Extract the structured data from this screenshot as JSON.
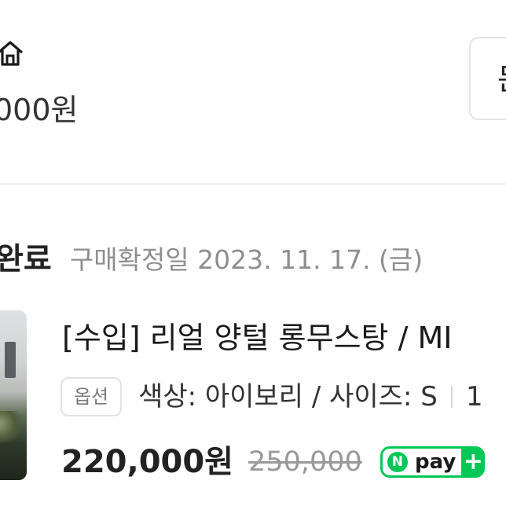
{
  "top": {
    "store_icon": "store-icon",
    "amount_text": "000원",
    "right_button_label": "문"
  },
  "order": {
    "status": "완료",
    "confirm_date": "구매확정일 2023. 11. 17. (금)"
  },
  "product": {
    "title": "[수입] 리얼 양털 롱무스탕 / MI",
    "option_badge": "옵션",
    "option_value": "색상: 아이보리 / 사이즈: S",
    "option_extra": "1",
    "sale_price": "220,000원",
    "original_price": "250,000",
    "npay_label": "pay",
    "npay_n": "N",
    "npay_plus": "+"
  },
  "colors": {
    "npay_green": "#05c756",
    "divider": "#ececec",
    "muted_text": "#8e8e8e"
  }
}
